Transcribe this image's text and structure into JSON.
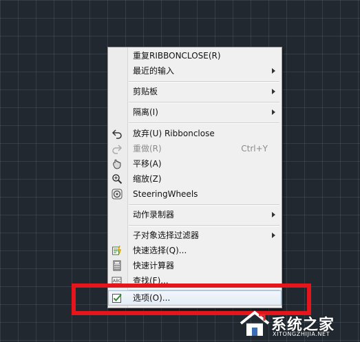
{
  "menu": {
    "items": [
      {
        "label": "重复RIBBONCLOSE(R)",
        "submenu": false
      },
      {
        "label": "最近的输入",
        "submenu": true
      },
      {
        "label": "剪贴板",
        "submenu": true
      },
      {
        "label": "隔离(I)",
        "submenu": true
      },
      {
        "label": "放弃(U) Ribbonclose",
        "icon": "undo-icon"
      },
      {
        "label": "重做(R)",
        "shortcut": "Ctrl+Y",
        "icon": "redo-icon",
        "disabled": true
      },
      {
        "label": "平移(A)",
        "icon": "pan-icon"
      },
      {
        "label": "缩放(Z)",
        "icon": "zoom-icon"
      },
      {
        "label": "SteeringWheels",
        "icon": "steering-wheels-icon"
      },
      {
        "label": "动作录制器",
        "submenu": true
      },
      {
        "label": "子对象选择过滤器",
        "submenu": true
      },
      {
        "label": "快速选择(Q)...",
        "icon": "quick-select-icon"
      },
      {
        "label": "快速计算器",
        "icon": "calculator-icon"
      },
      {
        "label": "查找(F)...",
        "icon": "find-icon"
      },
      {
        "label": "选项(O)...",
        "icon": "options-icon",
        "highlighted": true
      }
    ]
  },
  "watermark": {
    "text": "系统之家",
    "url": "XITONGZHIJIA.NET"
  },
  "colors": {
    "canvas_bg": "#212830",
    "menu_bg": "#f0f0f0",
    "annotation_red": "#e5161b"
  }
}
